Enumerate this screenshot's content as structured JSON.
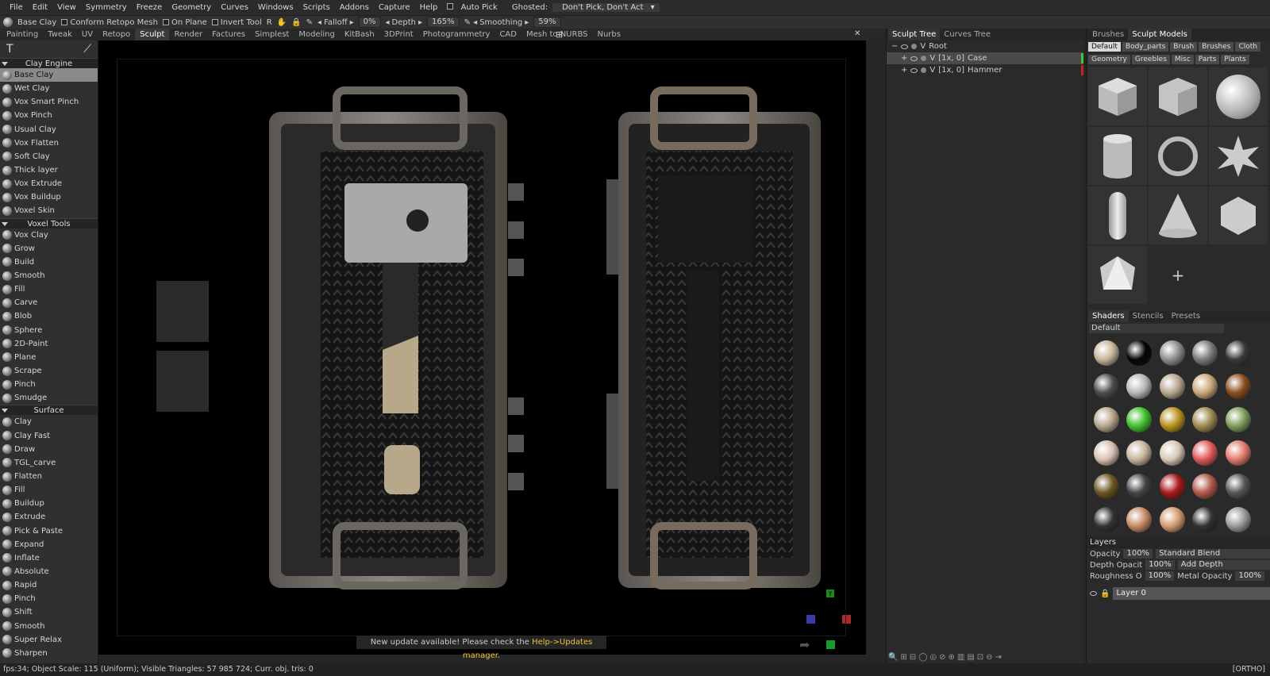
{
  "menu": [
    "File",
    "Edit",
    "View",
    "Symmetry",
    "Freeze",
    "Geometry",
    "Curves",
    "Windows",
    "Scripts",
    "Addons",
    "Capture",
    "Help"
  ],
  "menu_ext": {
    "auto_pick": "Auto Pick",
    "ghosted_label": "Ghosted:",
    "ghosted_value": "Don't Pick, Don't Act"
  },
  "toolbar": {
    "brush": "Base Clay",
    "conform": "Conform Retopo Mesh",
    "on_plane": "On Plane",
    "invert": "Invert Tool",
    "r": "R",
    "falloff_label": "Falloff",
    "falloff_value": "0%",
    "depth_label": "Depth",
    "depth_value": "165%",
    "smoothing_label": "Smoothing",
    "smoothing_value": "59%"
  },
  "room_tabs": [
    "Painting",
    "Tweak",
    "UV",
    "Retopo",
    "Sculpt",
    "Render",
    "Factures",
    "Simplest",
    "Modeling",
    "KitBash",
    "3DPrint",
    "Photogrammetry",
    "CAD",
    "Mesh to NURBS",
    "Nurbs"
  ],
  "active_room": "Sculpt",
  "tool_groups": [
    {
      "title": "Clay Engine",
      "items": [
        "Base Clay",
        "Wet Clay",
        "Vox Smart Pinch",
        "Vox Pinch",
        "Usual Clay",
        "Vox Flatten",
        "Soft Clay",
        "Thick layer",
        "Vox Extrude",
        "Vox Buildup",
        "Voxel Skin"
      ]
    },
    {
      "title": "Voxel Tools",
      "items": [
        "Vox Clay",
        "Grow",
        "Build",
        "Smooth",
        "Fill",
        "Carve",
        "Blob",
        "Sphere",
        "2D-Paint",
        "Plane",
        "Scrape",
        "Pinch",
        "Smudge"
      ]
    },
    {
      "title": "Surface",
      "items": [
        "Clay",
        "Clay Fast",
        "Draw",
        "TGL_carve",
        "Flatten",
        "Fill",
        "Buildup",
        "Extrude",
        "Pick & Paste",
        "Expand",
        "Inflate",
        "Absolute",
        "Rapid",
        "Pinch",
        "Shift",
        "Smooth",
        "Super Relax",
        "Sharpen"
      ]
    }
  ],
  "selected_tool": "Base Clay",
  "notice": {
    "text": "New update available! Please check the ",
    "link": "Help->Updates manager."
  },
  "axes": {
    "y": "Y"
  },
  "status": {
    "text": "fps:34;      Object Scale: 115 (Uniform); Visible Triangles: 57 985 724; Curr. obj. tris: 0",
    "mode": "[ORTHO]"
  },
  "tree": {
    "tabs": [
      "Sculpt Tree",
      "Curves Tree"
    ],
    "root": "Root",
    "rows": [
      {
        "tag": "[1x, 0]",
        "name": "Case",
        "color": "#3ec43e"
      },
      {
        "tag": "[1x, 0]",
        "name": "Hammer",
        "color": "#cc2222"
      }
    ],
    "v": "V"
  },
  "right": {
    "tabs": [
      "Brushes",
      "Sculpt Models"
    ],
    "model_chips_1": [
      "Default",
      "Body_parts",
      "Brush",
      "Brushes",
      "Cloth"
    ],
    "model_chips_2": [
      "Geometry",
      "Greebles",
      "Misc",
      "Parts",
      "Plants"
    ],
    "shader_tabs": [
      "Shaders",
      "Stencils",
      "Presets"
    ],
    "shader_set": "Default",
    "shader_colors": [
      "#c8b49a",
      "#050505",
      "#8c8c8c",
      "#7b7b7b",
      "#3a3a3a",
      "#4c4c4c",
      "#b7b7b7",
      "#b9a58e",
      "#c9a678",
      "#8a4c1c",
      "#b7a58d",
      "#3dbf2a",
      "#b8901c",
      "#9c8a50",
      "#7d9a5a",
      "#d8c0b0",
      "#c8b49a",
      "#d6c8b4",
      "#e05a5a",
      "#e07a6a",
      "#6a5420",
      "#444",
      "#aa1a1a",
      "#b0584a",
      "#555",
      "#333",
      "#c58a66",
      "#d49a70",
      "#333",
      "#999"
    ],
    "layers_title": "Layers",
    "opacity_label": "Opacity",
    "opacity_value": "100%",
    "blend": "Standard Blend",
    "depth_op_label": "Depth Opacit",
    "depth_op_value": "100%",
    "depth_mode": "Add Depth",
    "rough_label": "Roughness O",
    "rough_value": "100%",
    "metal_label": "Metal Opacity",
    "metal_value": "100%",
    "layer_name": "Layer 0"
  }
}
